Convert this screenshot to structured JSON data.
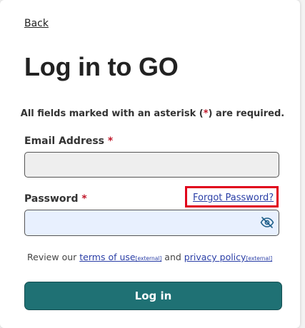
{
  "nav": {
    "back_label": "Back"
  },
  "title": "Log in to GO",
  "required_note": {
    "before": "All fields marked with an asterisk (",
    "asterisk": "*",
    "after": ") are required."
  },
  "email": {
    "label": "Email Address",
    "required_mark": "*",
    "value": "",
    "placeholder": ""
  },
  "password": {
    "label": "Password",
    "required_mark": "*",
    "value": "",
    "placeholder": "",
    "toggle_icon": "eye-off-icon"
  },
  "forgot_password_label": "Forgot Password?",
  "legal": {
    "prefix": "Review our ",
    "terms_label": "terms of use",
    "terms_external": "[external]",
    "conjunction": " and ",
    "privacy_label": "privacy policy",
    "privacy_external": "[external]"
  },
  "login_button_label": "Log in",
  "colors": {
    "primary_button": "#1f7174",
    "link": "#2a3ea6",
    "required": "#c0182a",
    "highlight_box": "#e0001b"
  }
}
